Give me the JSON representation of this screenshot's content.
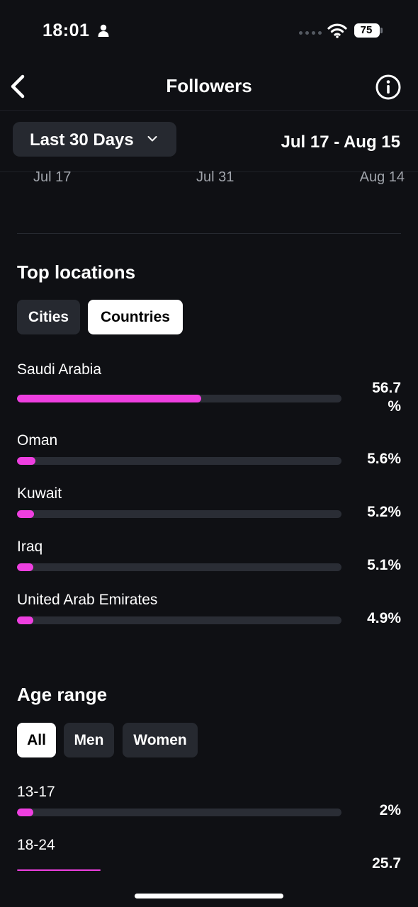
{
  "status_bar": {
    "time": "18:01",
    "battery": "75",
    "icons": [
      "person-icon",
      "signal-icon",
      "wifi-icon",
      "battery-icon"
    ]
  },
  "nav": {
    "title": "Followers",
    "icons": [
      "back-icon",
      "info-icon"
    ]
  },
  "filter": {
    "period": "Last 30 Days",
    "date_range": "Jul 17 - Aug 15"
  },
  "axis": {
    "labels": [
      "Jul 17",
      "Jul 31",
      "Aug 14"
    ]
  },
  "top_locations": {
    "title": "Top locations",
    "tabs": [
      {
        "label": "Cities",
        "active": false
      },
      {
        "label": "Countries",
        "active": true
      }
    ],
    "items": [
      {
        "label": "Saudi Arabia",
        "value": "56.7\n%",
        "percent": 56.7
      },
      {
        "label": "Oman",
        "value": "5.6%",
        "percent": 5.6
      },
      {
        "label": "Kuwait",
        "value": "5.2%",
        "percent": 5.2
      },
      {
        "label": "Iraq",
        "value": "5.1%",
        "percent": 5.1
      },
      {
        "label": "United Arab Emirates",
        "value": "4.9%",
        "percent": 4.9
      }
    ]
  },
  "age_range": {
    "title": "Age range",
    "tabs": [
      {
        "label": "All",
        "active": true
      },
      {
        "label": "Men",
        "active": false
      },
      {
        "label": "Women",
        "active": false
      }
    ],
    "items": [
      {
        "label": "13-17",
        "value": "2%",
        "percent": 2
      },
      {
        "label": "18-24",
        "value": "25.7",
        "percent": 25.7
      }
    ]
  },
  "colors": {
    "background": "#0f1014",
    "accent": "#ee3fe0",
    "track": "#2a2d35",
    "button": "#262930"
  }
}
